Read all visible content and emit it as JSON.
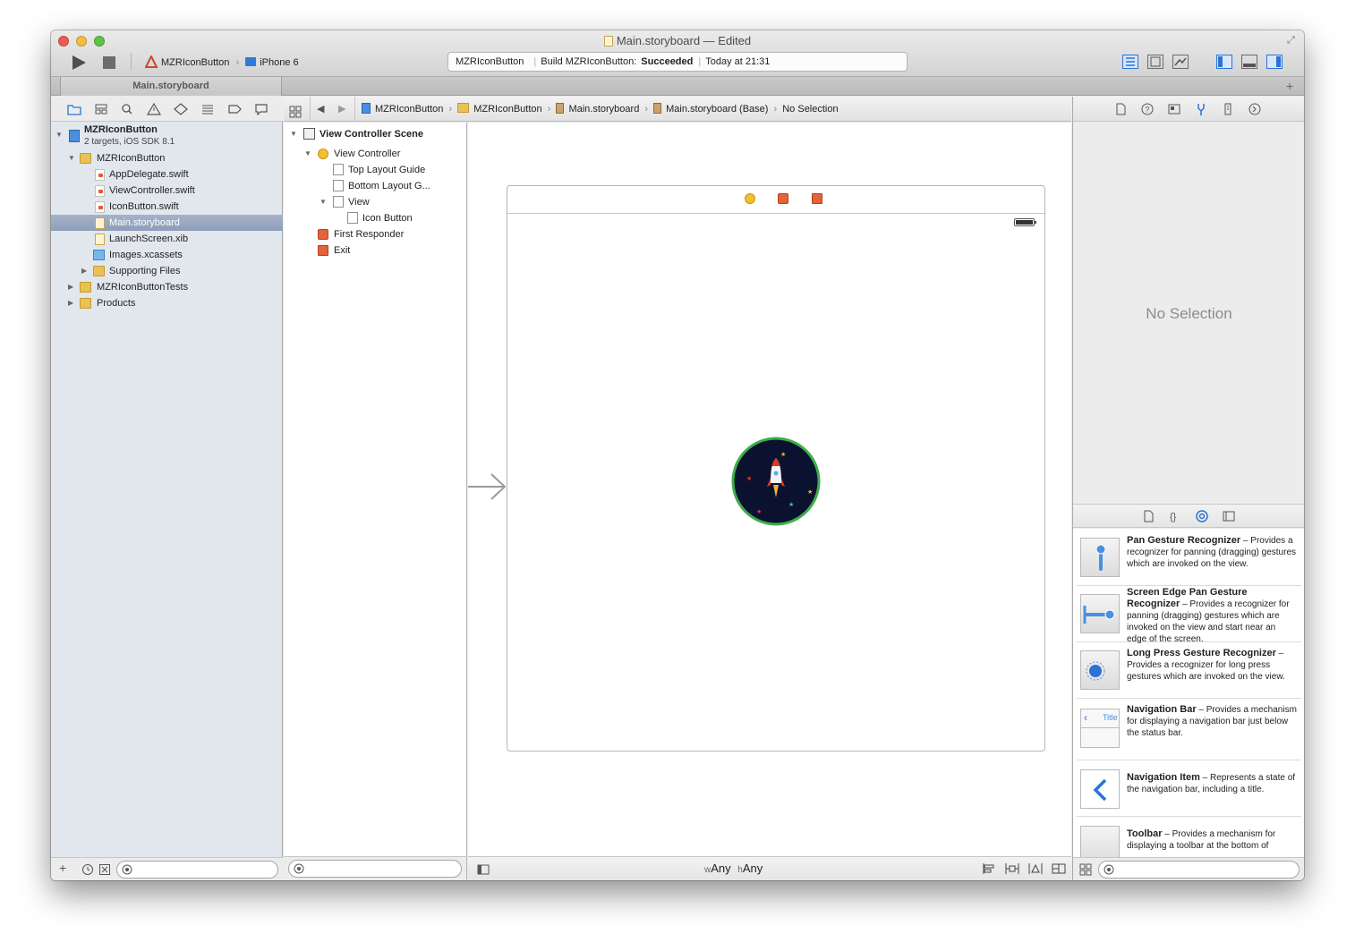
{
  "window": {
    "title": "Main.storyboard — Edited"
  },
  "toolbar": {
    "scheme_name": "MZRIconButton",
    "device_name": "iPhone 6",
    "status_project": "MZRIconButton",
    "status_build_prefix": "Build MZRIconButton:",
    "status_build_result": "Succeeded",
    "status_time": "Today at 21:31"
  },
  "tabs": [
    {
      "label": "Main.storyboard"
    }
  ],
  "navigator": {
    "project": {
      "name": "MZRIconButton",
      "subtitle": "2 targets, iOS SDK 8.1"
    },
    "items": [
      {
        "label": "MZRIconButton",
        "kind": "folder"
      },
      {
        "label": "AppDelegate.swift",
        "kind": "swift"
      },
      {
        "label": "ViewController.swift",
        "kind": "swift"
      },
      {
        "label": "IconButton.swift",
        "kind": "swift"
      },
      {
        "label": "Main.storyboard",
        "kind": "storyboard",
        "selected": true
      },
      {
        "label": "LaunchScreen.xib",
        "kind": "xib"
      },
      {
        "label": "Images.xcassets",
        "kind": "asset"
      },
      {
        "label": "Supporting Files",
        "kind": "folder"
      },
      {
        "label": "MZRIconButtonTests",
        "kind": "folder"
      },
      {
        "label": "Products",
        "kind": "folder"
      }
    ]
  },
  "jumpbar": {
    "crumbs": [
      "MZRIconButton",
      "MZRIconButton",
      "Main.storyboard",
      "Main.storyboard (Base)",
      "No Selection"
    ]
  },
  "outline": {
    "scene": "View Controller Scene",
    "items": [
      "View Controller",
      "Top Layout Guide",
      "Bottom Layout G...",
      "View",
      "Icon Button",
      "First Responder",
      "Exit"
    ]
  },
  "canvas": {
    "size_class_w_prefix": "w",
    "size_class_w": "Any",
    "size_class_h_prefix": "h",
    "size_class_h": "Any"
  },
  "inspector": {
    "empty_label": "No Selection"
  },
  "library": {
    "items": [
      {
        "title": "Pan Gesture Recognizer",
        "desc": " – Provides a recognizer for panning (dragging) gestures which are invoked on the view."
      },
      {
        "title": "Screen Edge Pan Gesture Recognizer",
        "desc": " – Provides a recognizer for panning (dragging) gestures which are invoked on the view and start near an edge of the screen."
      },
      {
        "title": "Long Press Gesture Recognizer",
        "desc": " – Provides a recognizer for long press gestures which are invoked on the view."
      },
      {
        "title": "Navigation Bar",
        "desc": " – Provides a mechanism for displaying a navigation bar just below the status bar."
      },
      {
        "title": "Navigation Item",
        "desc": " – Represents a state of the navigation bar, including a title."
      },
      {
        "title": "Toolbar",
        "desc": " – Provides a mechanism for displaying a toolbar at the bottom of"
      }
    ],
    "nav_bar_thumb_label": "Title"
  },
  "colors": {
    "selection": "#8e9db8",
    "folder": "#e8c157",
    "accent_blue": "#2a74d4",
    "icon_button_bg": "#0b1230",
    "icon_button_ring": "#3fae4a"
  }
}
